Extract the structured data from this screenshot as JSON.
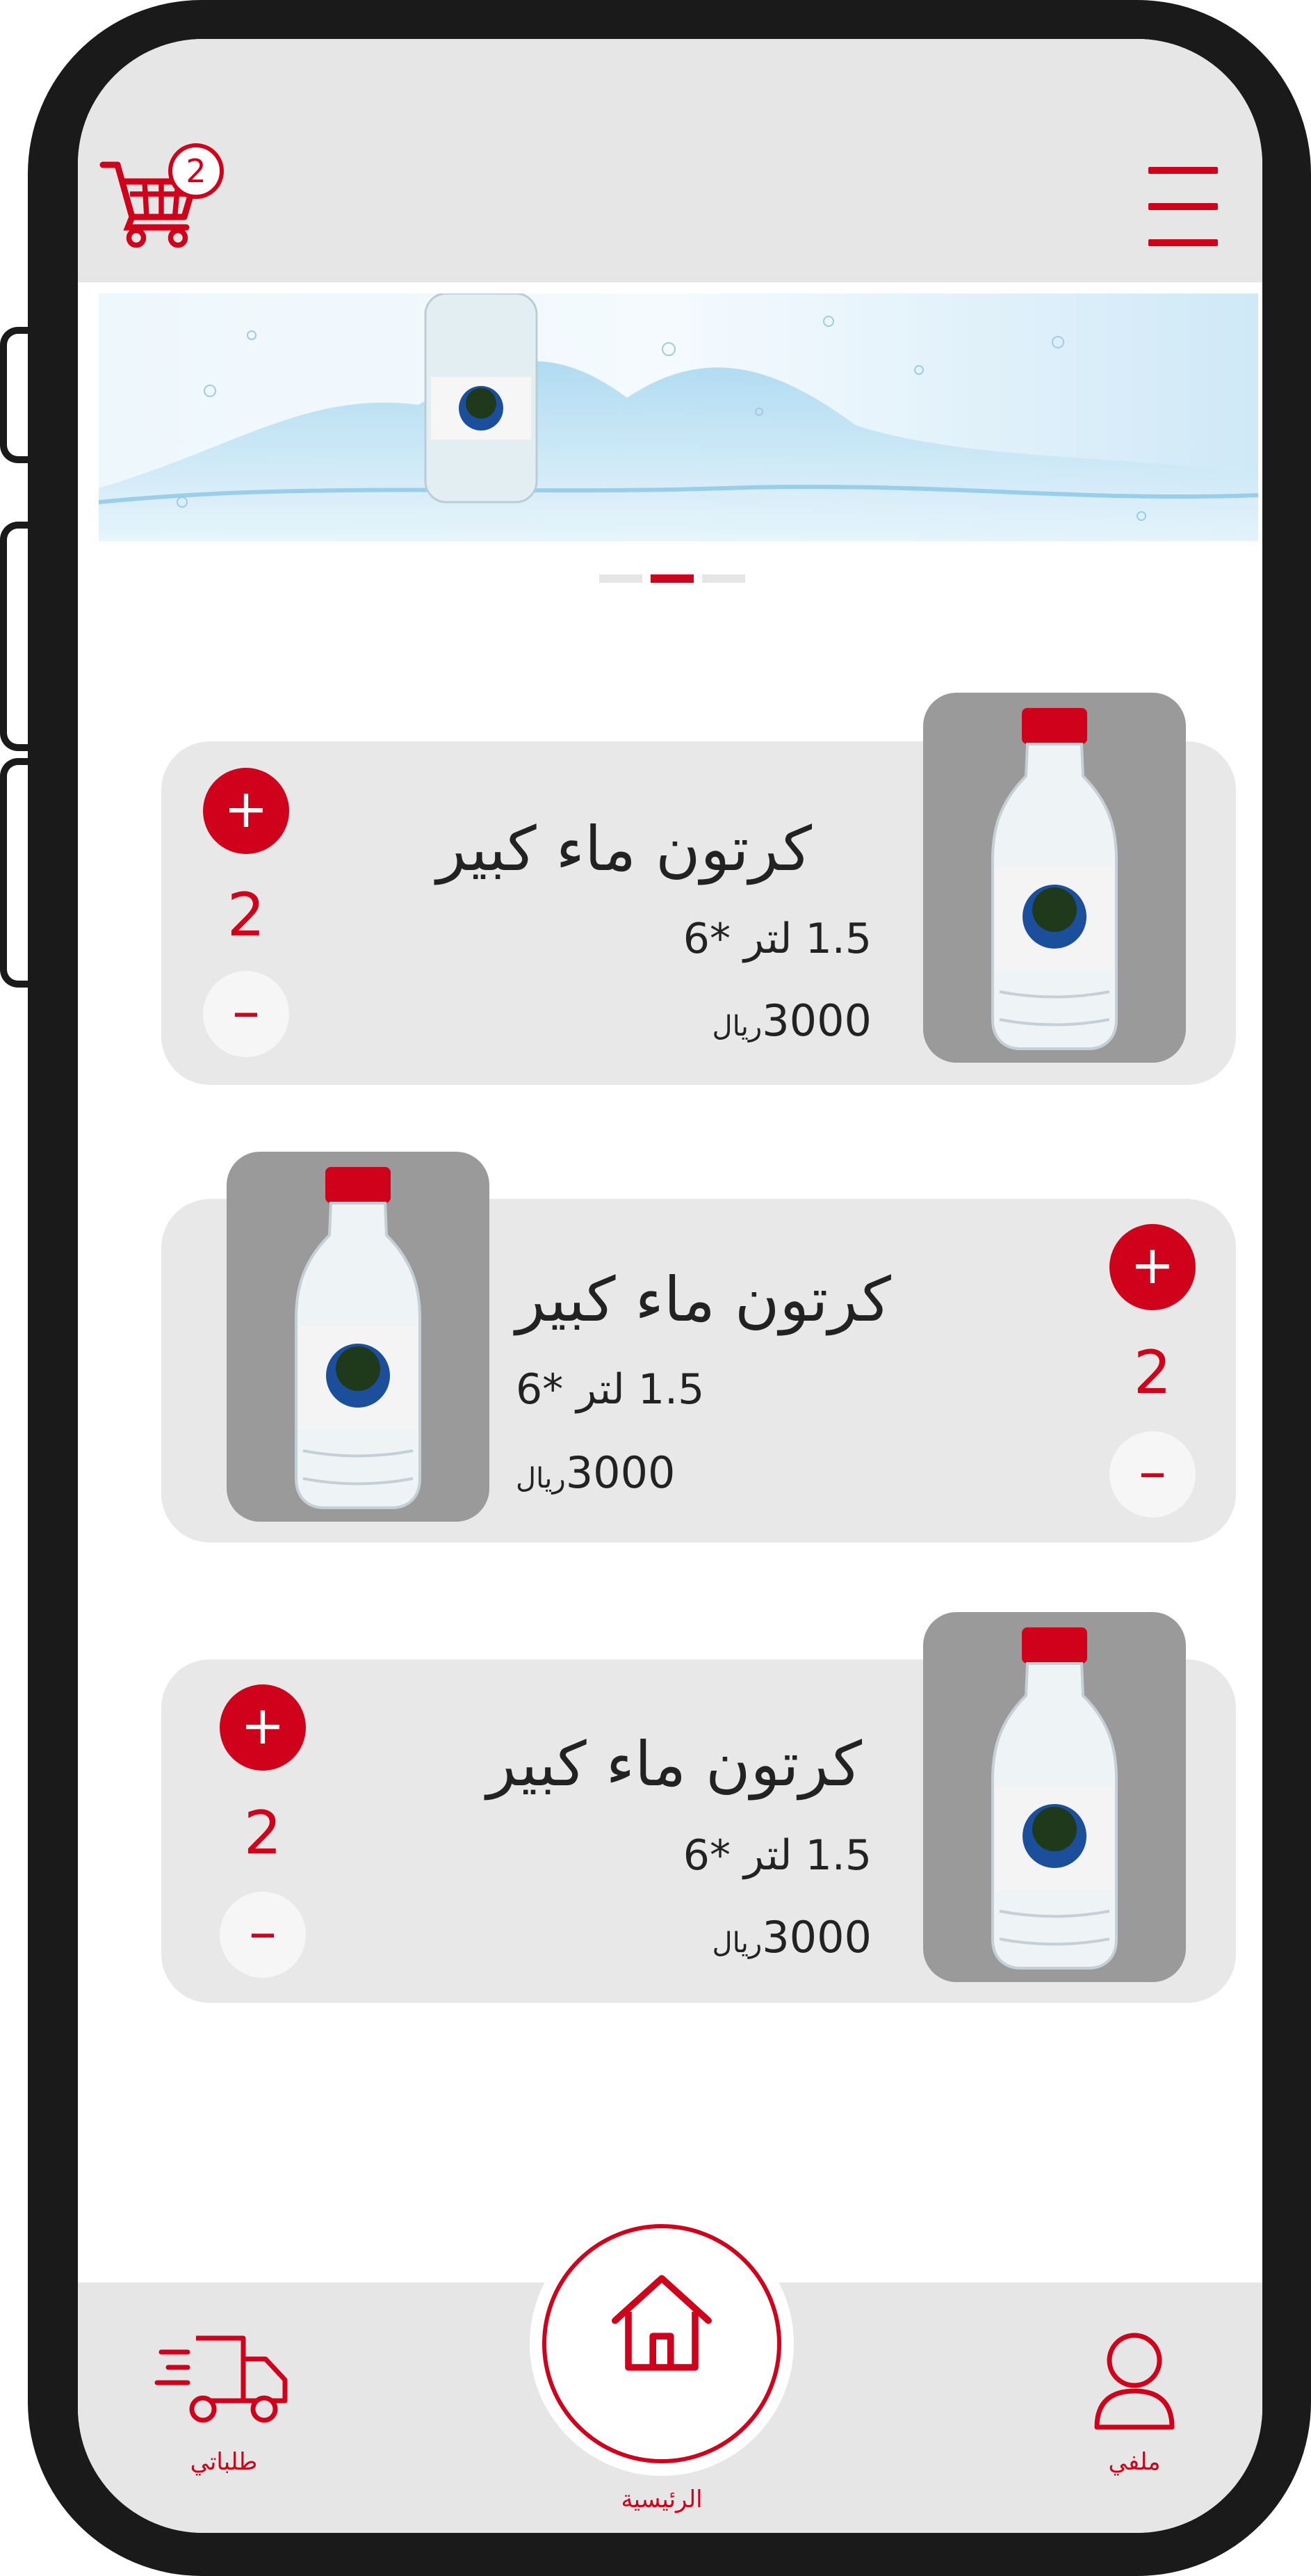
{
  "header": {
    "cart_count": "2",
    "cart_icon": "shopping-cart-icon",
    "menu_icon": "hamburger-menu-icon"
  },
  "banner": {
    "image": "water-splash-bottle-banner",
    "slides": 3,
    "active_slide": 2
  },
  "products": [
    {
      "title": "كرتون ماء كبير",
      "size": "1.5 لتر *6",
      "price": "3000",
      "currency": "ريال",
      "quantity": "2",
      "plus_label": "+",
      "minus_label": "–"
    },
    {
      "title": "كرتون ماء كبير",
      "size": "1.5 لتر *6",
      "price": "3000",
      "currency": "ريال",
      "quantity": "2",
      "plus_label": "+",
      "minus_label": "–"
    },
    {
      "title": "كرتون ماء كبير",
      "size": "1.5 لتر *6",
      "price": "3000",
      "currency": "ريال",
      "quantity": "2",
      "plus_label": "+",
      "minus_label": "–"
    }
  ],
  "bottom_nav": {
    "orders_label": "طلباتي",
    "home_label": "الرئيسية",
    "profile_label": "ملفي",
    "orders_icon": "delivery-truck-icon",
    "home_icon": "home-icon",
    "profile_icon": "user-icon"
  },
  "colors": {
    "accent": "#d0021b",
    "card_bg": "#e8e8e8",
    "header_bg": "#e6e6e6",
    "frame": "#1a1a1a"
  }
}
